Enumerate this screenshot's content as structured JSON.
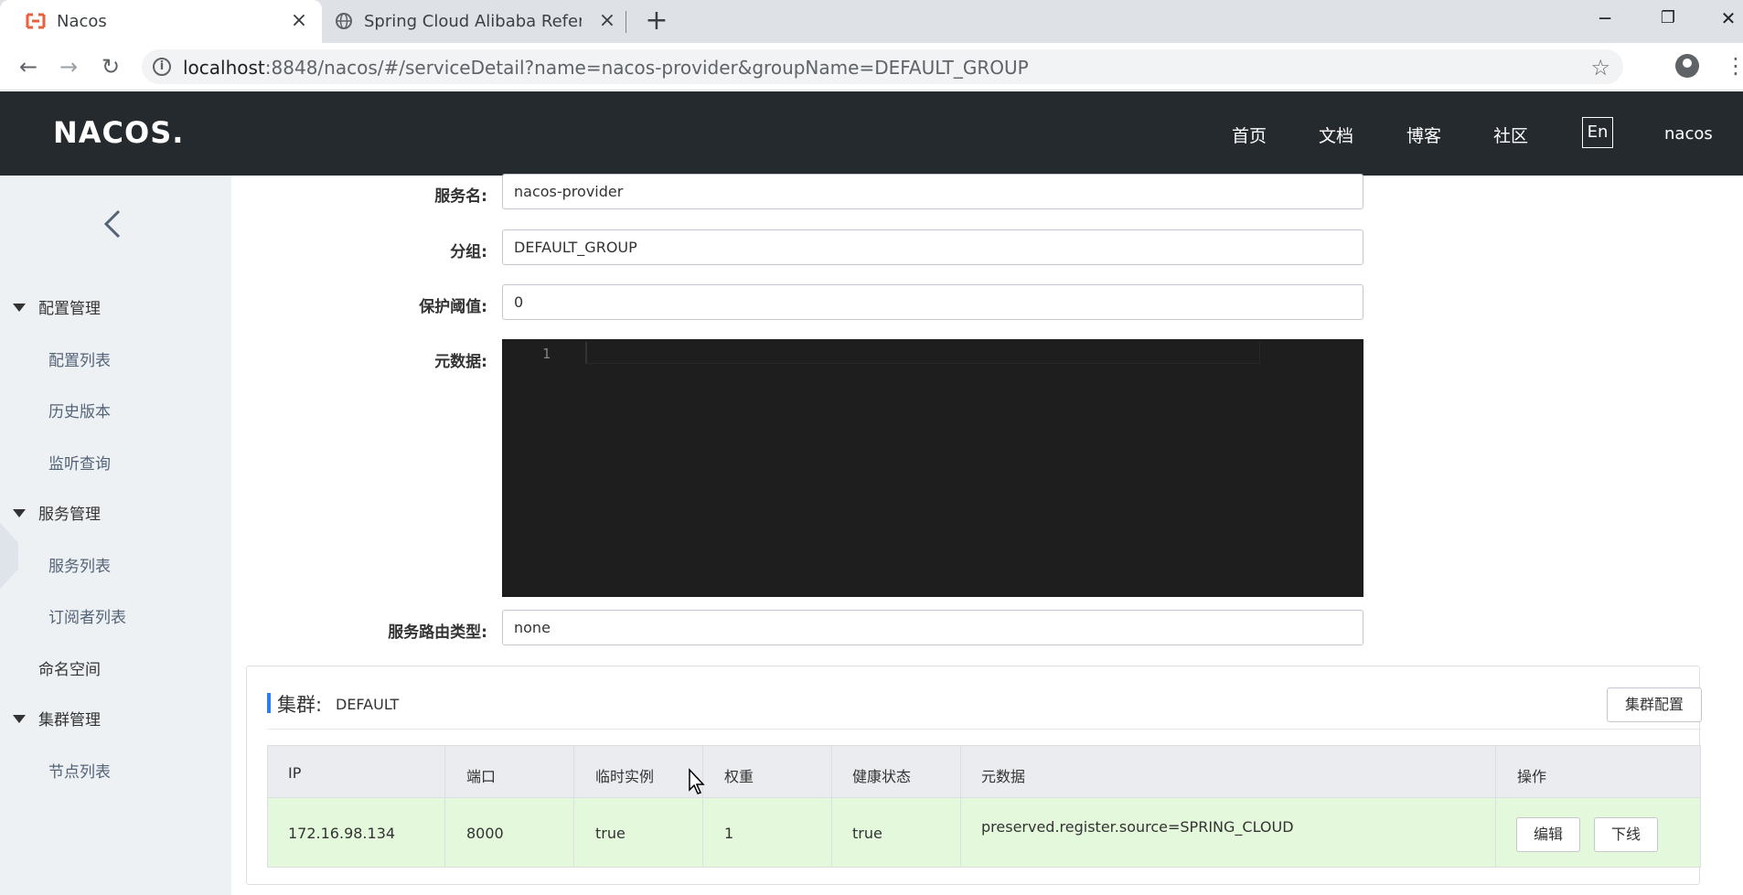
{
  "browser": {
    "tabs": [
      {
        "title": "Nacos",
        "active": true
      },
      {
        "title": "Spring Cloud Alibaba Referenc",
        "active": false
      }
    ],
    "url_host": "localhost",
    "url_rest": ":8848/nacos/#/serviceDetail?name=nacos-provider&groupName=DEFAULT_GROUP",
    "window_controls": {
      "minimize": "─",
      "restore": "❐",
      "close": "✕"
    }
  },
  "header": {
    "logo": "NACOS.",
    "nav": [
      "首页",
      "文档",
      "博客",
      "社区"
    ],
    "lang_button": "En",
    "user": "nacos"
  },
  "sidebar": {
    "groups": [
      {
        "label": "配置管理",
        "items": [
          "配置列表",
          "历史版本",
          "监听查询"
        ]
      },
      {
        "label": "服务管理",
        "items": [
          "服务列表",
          "订阅者列表"
        ]
      },
      {
        "label": "命名空间"
      },
      {
        "label": "集群管理",
        "items": [
          "节点列表"
        ]
      }
    ]
  },
  "form": {
    "service_name_label": "服务名:",
    "service_name_value": "nacos-provider",
    "group_label": "分组:",
    "group_value": "DEFAULT_GROUP",
    "threshold_label": "保护阈值:",
    "threshold_value": "0",
    "metadata_label": "元数据:",
    "metadata_line_number": "1",
    "selector_label": "服务路由类型:",
    "selector_value": "none"
  },
  "cluster": {
    "title": "集群:",
    "name": "DEFAULT",
    "config_button": "集群配置",
    "columns": [
      "IP",
      "端口",
      "临时实例",
      "权重",
      "健康状态",
      "元数据",
      "操作"
    ],
    "rows": [
      {
        "ip": "172.16.98.134",
        "port": "8000",
        "ephemeral": "true",
        "weight": "1",
        "healthy": "true",
        "metadata": "preserved.register.source=SPRING_CLOUD",
        "edit": "编辑",
        "offline": "下线"
      }
    ]
  },
  "colors": {
    "header_bg": "#252a2f",
    "sidebar_bg": "#eef1f4",
    "accent": "#2e7cf6",
    "row_bg": "#e4f8dc",
    "editor_bg": "#1e1e1e"
  }
}
